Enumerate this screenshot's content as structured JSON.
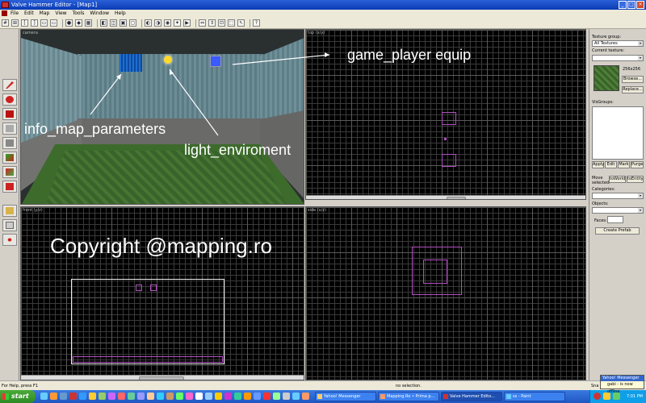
{
  "window": {
    "title": "Valve Hammer Editor - [Map1]"
  },
  "menu": [
    "File",
    "Edit",
    "Map",
    "View",
    "Tools",
    "Window",
    "Help"
  ],
  "viewports": {
    "camera": {
      "label": "camera"
    },
    "top": {
      "label": "top (x/y)"
    },
    "front": {
      "label": "front (y/z)"
    },
    "side": {
      "label": "side (x/z)"
    }
  },
  "annotations": {
    "game_player_equip": "game_player equip",
    "info_map_parameters": "info_map_parameters",
    "light_environment": "light_enviroment",
    "copyright": "Copyright @mapping.ro"
  },
  "texture_panel": {
    "group_label": "Texture group:",
    "group_value": "All Textures",
    "current_label": "Current texture:",
    "current_value": "",
    "size": "256x256",
    "browse": "Browse...",
    "replace": "Replace..."
  },
  "visgroups": {
    "label": "VisGroups:",
    "buttons": [
      "Apply",
      "Edit",
      "Mark",
      "Purge"
    ]
  },
  "move_selected": {
    "label": "Move selected:",
    "to_world": "toWorld",
    "to_entity": "toEntity"
  },
  "categories": {
    "label": "Categories:",
    "value": ""
  },
  "objects": {
    "label": "Objects:",
    "value": ""
  },
  "faces": {
    "label": "Faces:",
    "value": ""
  },
  "create_prefab": "Create Prefab",
  "status": {
    "help": "For Help, press F1",
    "selection": "no selection.",
    "snap": "Sna"
  },
  "taskbar": {
    "start": "start",
    "tasks": [
      "Yahoo! Messenger",
      "Mapping.Ro • Prima p...",
      "Valve Hammer Edito...",
      "ss - Paint"
    ],
    "clock": "7:01 PM"
  },
  "notification": {
    "header": "Yahoo! Messenger",
    "message": "gabi - is now offline"
  }
}
